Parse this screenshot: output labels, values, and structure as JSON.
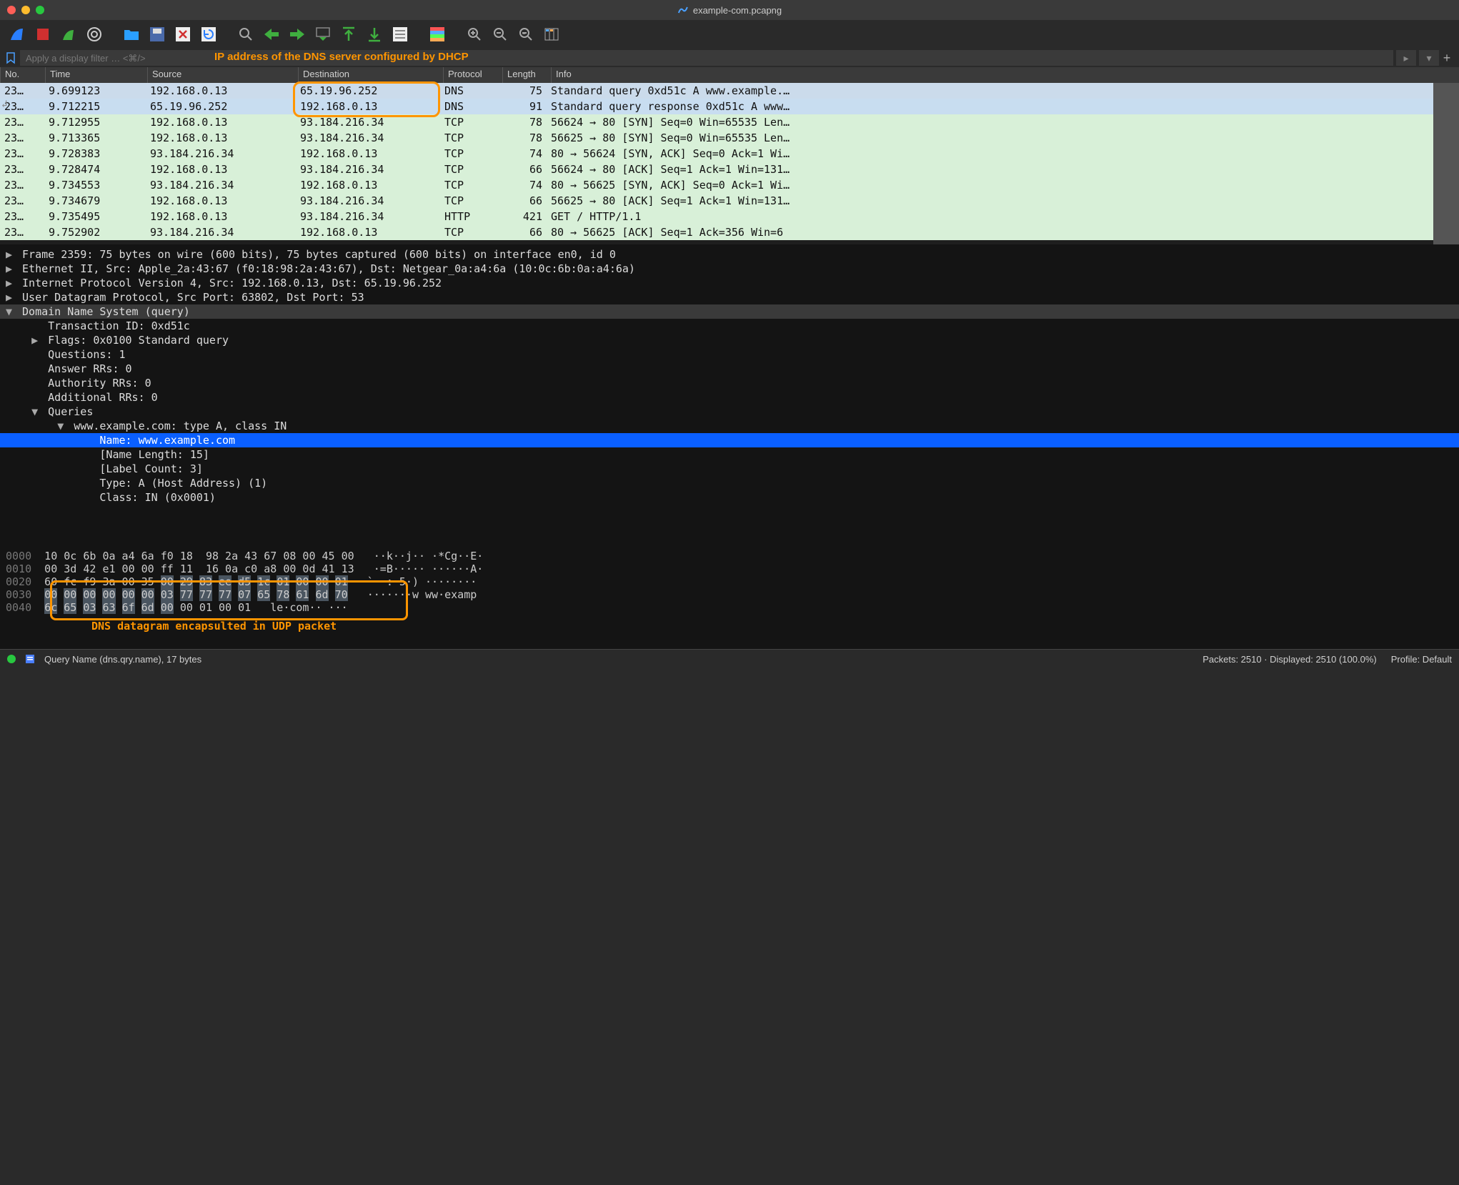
{
  "title": "example-com.pcapng",
  "filter_placeholder": "Apply a display filter … <⌘/>",
  "annotation_top": "IP address of the DNS server configured by DHCP",
  "annotation_bottom": "DNS datagram encapsulted in UDP packet",
  "columns": {
    "no": "No.",
    "time": "Time",
    "src": "Source",
    "dst": "Destination",
    "proto": "Protocol",
    "len": "Length",
    "info": "Info"
  },
  "packets": [
    {
      "no": "23…",
      "time": "9.699123",
      "src": "192.168.0.13",
      "dst": "65.19.96.252",
      "proto": "DNS",
      "len": "75",
      "info": "Standard query 0xd51c A www.example.…",
      "cls": "r-dns-q",
      "arrow": "→"
    },
    {
      "no": "23…",
      "time": "9.712215",
      "src": "65.19.96.252",
      "dst": "192.168.0.13",
      "proto": "DNS",
      "len": "91",
      "info": "Standard query response 0xd51c A www…",
      "cls": "r-dns-r",
      "arrow": "↲"
    },
    {
      "no": "23…",
      "time": "9.712955",
      "src": "192.168.0.13",
      "dst": "93.184.216.34",
      "proto": "TCP",
      "len": "78",
      "info": "56624 → 80 [SYN] Seq=0 Win=65535 Len…",
      "cls": "r-tcp"
    },
    {
      "no": "23…",
      "time": "9.713365",
      "src": "192.168.0.13",
      "dst": "93.184.216.34",
      "proto": "TCP",
      "len": "78",
      "info": "56625 → 80 [SYN] Seq=0 Win=65535 Len…",
      "cls": "r-tcp"
    },
    {
      "no": "23…",
      "time": "9.728383",
      "src": "93.184.216.34",
      "dst": "192.168.0.13",
      "proto": "TCP",
      "len": "74",
      "info": "80 → 56624 [SYN, ACK] Seq=0 Ack=1 Wi…",
      "cls": "r-tcp"
    },
    {
      "no": "23…",
      "time": "9.728474",
      "src": "192.168.0.13",
      "dst": "93.184.216.34",
      "proto": "TCP",
      "len": "66",
      "info": "56624 → 80 [ACK] Seq=1 Ack=1 Win=131…",
      "cls": "r-tcp"
    },
    {
      "no": "23…",
      "time": "9.734553",
      "src": "93.184.216.34",
      "dst": "192.168.0.13",
      "proto": "TCP",
      "len": "74",
      "info": "80 → 56625 [SYN, ACK] Seq=0 Ack=1 Wi…",
      "cls": "r-tcp"
    },
    {
      "no": "23…",
      "time": "9.734679",
      "src": "192.168.0.13",
      "dst": "93.184.216.34",
      "proto": "TCP",
      "len": "66",
      "info": "56625 → 80 [ACK] Seq=1 Ack=1 Win=131…",
      "cls": "r-tcp"
    },
    {
      "no": "23…",
      "time": "9.735495",
      "src": "192.168.0.13",
      "dst": "93.184.216.34",
      "proto": "HTTP",
      "len": "421",
      "info": "GET / HTTP/1.1 ",
      "cls": "r-http"
    },
    {
      "no": "23…",
      "time": "9.752902",
      "src": "93.184.216.34",
      "dst": "192.168.0.13",
      "proto": "TCP",
      "len": "66",
      "info": "80 → 56625 [ACK] Seq=1 Ack=356 Win=6",
      "cls": "r-tcp"
    }
  ],
  "tree": [
    {
      "ind": 0,
      "exp": "▶",
      "txt": "Frame 2359: 75 bytes on wire (600 bits), 75 bytes captured (600 bits) on interface en0, id 0"
    },
    {
      "ind": 0,
      "exp": "▶",
      "txt": "Ethernet II, Src: Apple_2a:43:67 (f0:18:98:2a:43:67), Dst: Netgear_0a:a4:6a (10:0c:6b:0a:a4:6a)"
    },
    {
      "ind": 0,
      "exp": "▶",
      "txt": "Internet Protocol Version 4, Src: 192.168.0.13, Dst: 65.19.96.252"
    },
    {
      "ind": 0,
      "exp": "▶",
      "txt": "User Datagram Protocol, Src Port: 63802, Dst Port: 53"
    },
    {
      "ind": 0,
      "exp": "▼",
      "txt": "Domain Name System (query)",
      "hdr": true
    },
    {
      "ind": 2,
      "exp": " ",
      "txt": "Transaction ID: 0xd51c"
    },
    {
      "ind": 2,
      "exp": "▶",
      "txt": "Flags: 0x0100 Standard query"
    },
    {
      "ind": 2,
      "exp": " ",
      "txt": "Questions: 1"
    },
    {
      "ind": 2,
      "exp": " ",
      "txt": "Answer RRs: 0"
    },
    {
      "ind": 2,
      "exp": " ",
      "txt": "Authority RRs: 0"
    },
    {
      "ind": 2,
      "exp": " ",
      "txt": "Additional RRs: 0"
    },
    {
      "ind": 2,
      "exp": "▼",
      "txt": "Queries"
    },
    {
      "ind": 4,
      "exp": "▼",
      "txt": "www.example.com: type A, class IN"
    },
    {
      "ind": 6,
      "exp": " ",
      "txt": "Name: www.example.com",
      "sel": true
    },
    {
      "ind": 6,
      "exp": " ",
      "txt": "[Name Length: 15]"
    },
    {
      "ind": 6,
      "exp": " ",
      "txt": "[Label Count: 3]"
    },
    {
      "ind": 6,
      "exp": " ",
      "txt": "Type: A (Host Address) (1)"
    },
    {
      "ind": 6,
      "exp": " ",
      "txt": "Class: IN (0x0001)"
    }
  ],
  "hex": [
    {
      "off": "0000",
      "b": "10 0c 6b 0a a4 6a f0 18  98 2a 43 67 08 00 45 00",
      "a": "··k··j·· ·*Cg··E·"
    },
    {
      "off": "0010",
      "b": "00 3d 42 e1 00 00 ff 11  16 0a c0 a8 00 0d 41 13",
      "a": "·=B····· ······A·"
    },
    {
      "off": "0020",
      "b": "60 fc f9 3a 00 35 00 29  83 ee d5 1c 01 00 00 01",
      "a": "`··:·5·) ········",
      "sel": [
        6,
        16
      ]
    },
    {
      "off": "0030",
      "b": "00 00 00 00 00 00 03 77  77 77 07 65 78 61 6d 70",
      "a": "·······w ww·examp",
      "sel": [
        0,
        16
      ]
    },
    {
      "off": "0040",
      "b": "6c 65 03 63 6f 6d 00 00  01 00 01",
      "a": "le·com·· ···",
      "sel": [
        0,
        7
      ]
    }
  ],
  "status": {
    "left": "Query Name (dns.qry.name), 17 bytes",
    "mid": "Packets: 2510 · Displayed: 2510 (100.0%)",
    "right": "Profile: Default"
  }
}
